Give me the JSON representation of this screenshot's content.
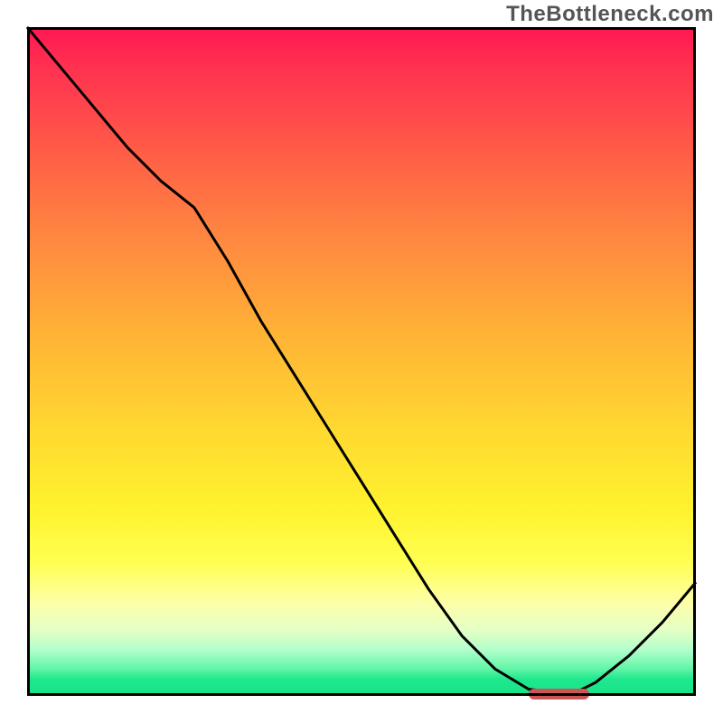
{
  "watermark": "TheBottleneck.com",
  "chart_data": {
    "type": "line",
    "title": "",
    "xlabel": "",
    "ylabel": "",
    "xlim": [
      0,
      100
    ],
    "ylim": [
      0,
      100
    ],
    "grid": false,
    "legend": false,
    "background": {
      "type": "vertical_gradient",
      "stops": [
        {
          "pos": 0,
          "color": "#ff1852"
        },
        {
          "pos": 0.06,
          "color": "#ff3150"
        },
        {
          "pos": 0.2,
          "color": "#ff6146"
        },
        {
          "pos": 0.32,
          "color": "#ff8940"
        },
        {
          "pos": 0.46,
          "color": "#ffb336"
        },
        {
          "pos": 0.6,
          "color": "#ffd830"
        },
        {
          "pos": 0.72,
          "color": "#fff22e"
        },
        {
          "pos": 0.8,
          "color": "#ffff50"
        },
        {
          "pos": 0.86,
          "color": "#fdffa8"
        },
        {
          "pos": 0.9,
          "color": "#e6ffc4"
        },
        {
          "pos": 0.93,
          "color": "#b4ffcc"
        },
        {
          "pos": 0.96,
          "color": "#60f5a6"
        },
        {
          "pos": 0.975,
          "color": "#1fe88e"
        },
        {
          "pos": 1.0,
          "color": "#17e386"
        }
      ]
    },
    "series": [
      {
        "name": "bottleneck-curve",
        "color": "#000000",
        "stroke_width": 3,
        "x": [
          0,
          5,
          10,
          15,
          20,
          25,
          30,
          35,
          40,
          45,
          50,
          55,
          60,
          65,
          70,
          75,
          80,
          82,
          85,
          90,
          95,
          100
        ],
        "y": [
          100,
          94,
          88,
          82,
          77,
          73,
          65,
          56,
          48,
          40,
          32,
          24,
          16,
          9,
          4,
          1,
          0.5,
          0.5,
          2,
          6,
          11,
          17
        ]
      }
    ],
    "markers": [
      {
        "name": "optimal-zone",
        "shape": "rounded_bar",
        "color": "#cb5658",
        "x_start": 75,
        "x_end": 84,
        "y": 0.3
      }
    ]
  }
}
